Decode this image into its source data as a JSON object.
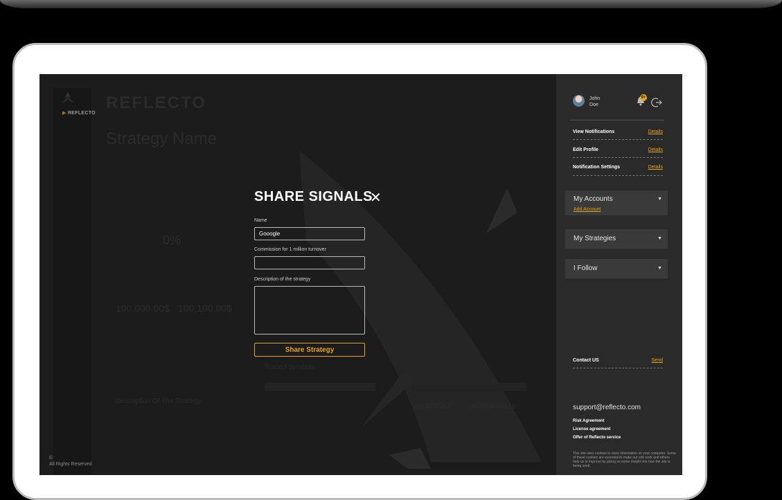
{
  "brand": {
    "name_small": "REFLECTO",
    "name_large": "REFLECTO"
  },
  "page": {
    "title": "Strategy Name",
    "copyright_symbol": "©",
    "copyright_text": "All Rights Reserved"
  },
  "modal": {
    "title": "SHARE SIGNALS",
    "close_glyph": "✕",
    "name_label": "Name",
    "name_value": "Gooogle",
    "commission_label": "Commission for 1 million turnover",
    "commission_value": "",
    "description_label": "Description of the strategy",
    "description_value": "",
    "share_button": "Share Strategy"
  },
  "dimmed": {
    "percent": "0%",
    "balance_a": "100,000.00$",
    "balance_b": "100,100.00$",
    "description_heading": "Description Of The Strategy",
    "traded_symbols": "Traded Symbols",
    "profitable": "PROFITABLE",
    "unprofitable": "UNPROFITABLE"
  },
  "user": {
    "first_name": "John",
    "last_name": "Doe",
    "notification_count": "9+"
  },
  "menu": {
    "view_notifications": "View Notifications",
    "edit_profile": "Edit Profile",
    "notification_settings": "Notification Settings",
    "details": "Details"
  },
  "accordions": {
    "my_accounts": "My Accounts",
    "add_account": "Add Account",
    "my_strategies": "My Strategies",
    "i_follow": "I Follow",
    "caret": "▼"
  },
  "contact": {
    "label": "Contact US",
    "send": "Send"
  },
  "footer": {
    "email": "support@reflecto.com",
    "risk": "Risk Agreement",
    "license": "License agreement",
    "offer": "Offer of Reflecto service",
    "cookie": "This site uses cookies to store information on your computer. Some of these cookies are essential to make our site work and others help us to improve by giving us some insight into how the site is being used."
  },
  "colors": {
    "accent": "#e8a317",
    "panel": "#2a2a2a",
    "background": "#1c1c1c"
  }
}
